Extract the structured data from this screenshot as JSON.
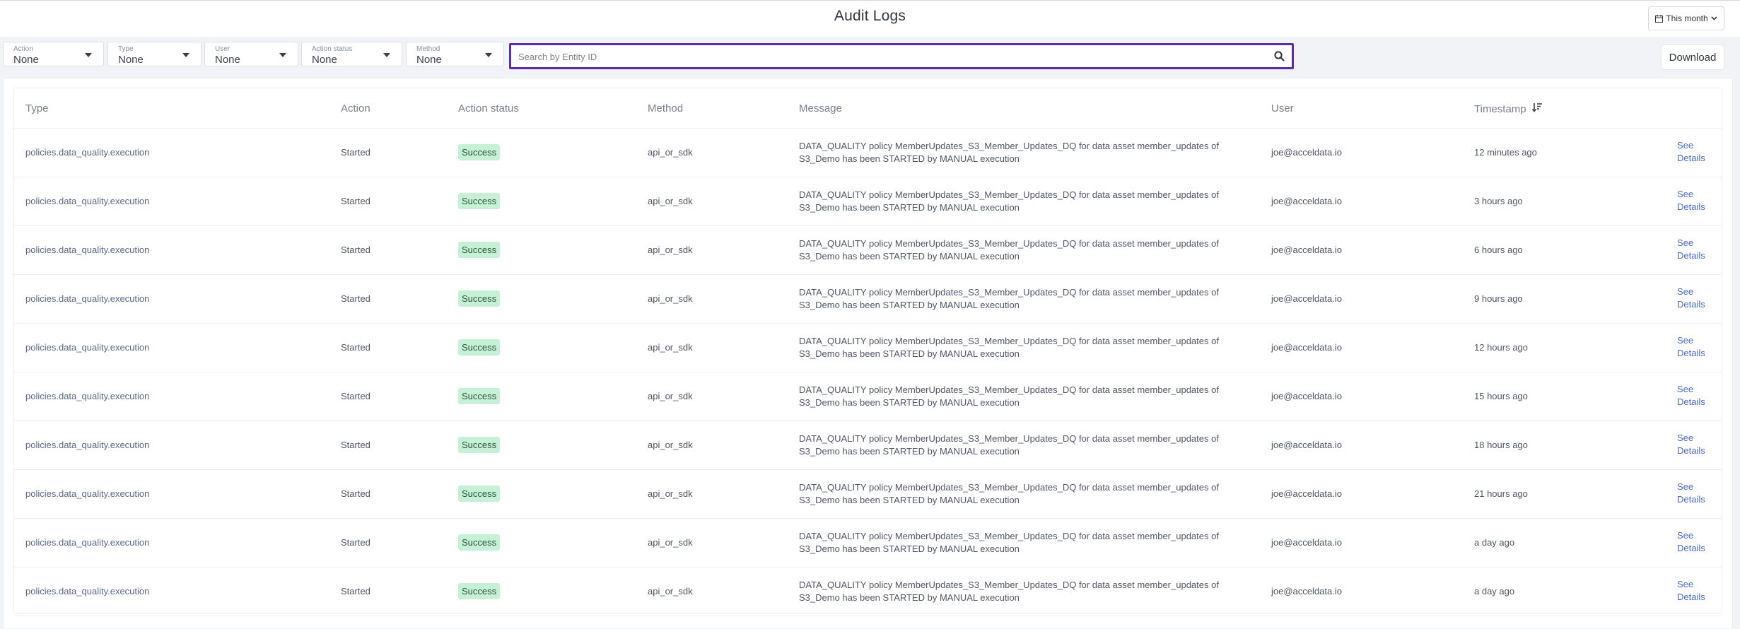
{
  "header": {
    "title": "Audit Logs",
    "date_range": "This month"
  },
  "filters": [
    {
      "label": "Action",
      "value": "None"
    },
    {
      "label": "Type",
      "value": "None"
    },
    {
      "label": "User",
      "value": "None"
    },
    {
      "label": "Action status",
      "value": "None"
    },
    {
      "label": "Method",
      "value": "None"
    }
  ],
  "search": {
    "placeholder": "Search by Entity ID",
    "value": ""
  },
  "download_label": "Download",
  "table": {
    "columns": [
      "Type",
      "Action",
      "Action status",
      "Method",
      "Message",
      "User",
      "Timestamp"
    ],
    "sort_column": "Timestamp",
    "details_label": "See Details",
    "rows": [
      {
        "type": "policies.data_quality.execution",
        "action": "Started",
        "status": "Success",
        "method": "api_or_sdk",
        "message": "DATA_QUALITY policy MemberUpdates_S3_Member_Updates_DQ for data asset member_updates of S3_Demo has been STARTED by MANUAL execution",
        "user": "joe@acceldata.io",
        "timestamp": "12 minutes ago"
      },
      {
        "type": "policies.data_quality.execution",
        "action": "Started",
        "status": "Success",
        "method": "api_or_sdk",
        "message": "DATA_QUALITY policy MemberUpdates_S3_Member_Updates_DQ for data asset member_updates of S3_Demo has been STARTED by MANUAL execution",
        "user": "joe@acceldata.io",
        "timestamp": "3 hours ago"
      },
      {
        "type": "policies.data_quality.execution",
        "action": "Started",
        "status": "Success",
        "method": "api_or_sdk",
        "message": "DATA_QUALITY policy MemberUpdates_S3_Member_Updates_DQ for data asset member_updates of S3_Demo has been STARTED by MANUAL execution",
        "user": "joe@acceldata.io",
        "timestamp": "6 hours ago"
      },
      {
        "type": "policies.data_quality.execution",
        "action": "Started",
        "status": "Success",
        "method": "api_or_sdk",
        "message": "DATA_QUALITY policy MemberUpdates_S3_Member_Updates_DQ for data asset member_updates of S3_Demo has been STARTED by MANUAL execution",
        "user": "joe@acceldata.io",
        "timestamp": "9 hours ago"
      },
      {
        "type": "policies.data_quality.execution",
        "action": "Started",
        "status": "Success",
        "method": "api_or_sdk",
        "message": "DATA_QUALITY policy MemberUpdates_S3_Member_Updates_DQ for data asset member_updates of S3_Demo has been STARTED by MANUAL execution",
        "user": "joe@acceldata.io",
        "timestamp": "12 hours ago"
      },
      {
        "type": "policies.data_quality.execution",
        "action": "Started",
        "status": "Success",
        "method": "api_or_sdk",
        "message": "DATA_QUALITY policy MemberUpdates_S3_Member_Updates_DQ for data asset member_updates of S3_Demo has been STARTED by MANUAL execution",
        "user": "joe@acceldata.io",
        "timestamp": "15 hours ago"
      },
      {
        "type": "policies.data_quality.execution",
        "action": "Started",
        "status": "Success",
        "method": "api_or_sdk",
        "message": "DATA_QUALITY policy MemberUpdates_S3_Member_Updates_DQ for data asset member_updates of S3_Demo has been STARTED by MANUAL execution",
        "user": "joe@acceldata.io",
        "timestamp": "18 hours ago"
      },
      {
        "type": "policies.data_quality.execution",
        "action": "Started",
        "status": "Success",
        "method": "api_or_sdk",
        "message": "DATA_QUALITY policy MemberUpdates_S3_Member_Updates_DQ for data asset member_updates of S3_Demo has been STARTED by MANUAL execution",
        "user": "joe@acceldata.io",
        "timestamp": "21 hours ago"
      },
      {
        "type": "policies.data_quality.execution",
        "action": "Started",
        "status": "Success",
        "method": "api_or_sdk",
        "message": "DATA_QUALITY policy MemberUpdates_S3_Member_Updates_DQ for data asset member_updates of S3_Demo has been STARTED by MANUAL execution",
        "user": "joe@acceldata.io",
        "timestamp": "a day ago"
      },
      {
        "type": "policies.data_quality.execution",
        "action": "Started",
        "status": "Success",
        "method": "api_or_sdk",
        "message": "DATA_QUALITY policy MemberUpdates_S3_Member_Updates_DQ for data asset member_updates of S3_Demo has been STARTED by MANUAL execution",
        "user": "joe@acceldata.io",
        "timestamp": "a day ago"
      }
    ]
  },
  "colors": {
    "accent": "#5a2ea6",
    "success_bg": "#c6f1d6",
    "success_text": "#29563a",
    "link": "#4a6cc9"
  },
  "icons": {
    "date_range": "calendar-icon",
    "date_caret": "chevron-down-icon",
    "search": "search-icon",
    "sort": "sort-descending-icon"
  }
}
